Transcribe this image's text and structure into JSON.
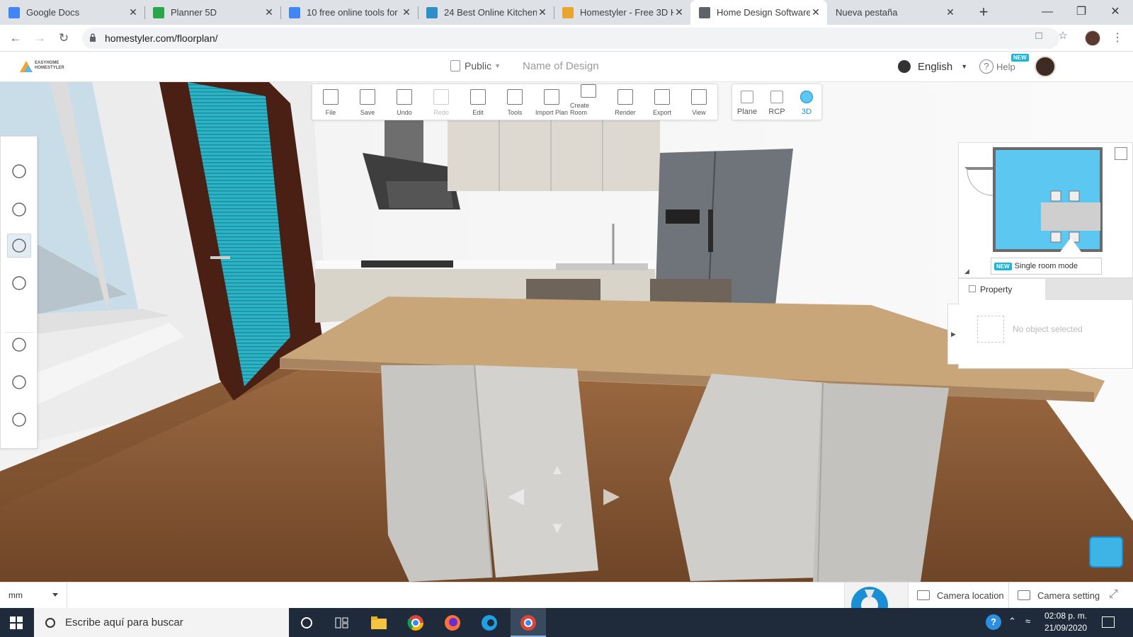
{
  "browser": {
    "tabs": [
      {
        "title": "Google Docs",
        "icon": "google-docs-icon",
        "color": "#4285f4",
        "active": false
      },
      {
        "title": "Planner 5D",
        "icon": "planner5d-icon",
        "color": "#2aa64a",
        "active": false
      },
      {
        "title": "10 free online tools for",
        "icon": "google-docs-icon",
        "color": "#4285f4",
        "active": false
      },
      {
        "title": "24 Best Online Kitchen",
        "icon": "home-icon",
        "color": "#2f8fc9",
        "active": false
      },
      {
        "title": "Homestyler - Free 3D H",
        "icon": "homestyler-icon",
        "color": "#e8a630",
        "active": false
      },
      {
        "title": "Home Design Software",
        "icon": "globe-icon",
        "color": "#5f6368",
        "active": true
      },
      {
        "title": "Nueva pestaña",
        "icon": "",
        "color": "#fff",
        "active": false
      }
    ],
    "url": "homestyler.com/floorplan/"
  },
  "app": {
    "logo_line1": "EASYHOME",
    "logo_line2": "HOMESTYLER",
    "visibility": "Public",
    "design_name_placeholder": "Name of Design",
    "language": "English",
    "help": "Help",
    "new_badge": "NEW"
  },
  "toolbar": {
    "tools": [
      {
        "label": "File",
        "icon": "file-icon",
        "disabled": false
      },
      {
        "label": "Save",
        "icon": "save-icon",
        "disabled": false
      },
      {
        "label": "Undo",
        "icon": "undo-icon",
        "disabled": false
      },
      {
        "label": "Redo",
        "icon": "redo-icon",
        "disabled": true
      },
      {
        "label": "Edit",
        "icon": "edit-icon",
        "disabled": false
      },
      {
        "label": "Tools",
        "icon": "ruler-icon",
        "disabled": false
      },
      {
        "label": "Import Plan",
        "icon": "import-plan-icon",
        "disabled": false
      },
      {
        "label": "Create Room",
        "icon": "create-room-icon",
        "disabled": false
      },
      {
        "label": "Render",
        "icon": "render-icon",
        "disabled": false
      },
      {
        "label": "Export",
        "icon": "export-icon",
        "disabled": false
      },
      {
        "label": "View",
        "icon": "eye-icon",
        "disabled": false
      }
    ],
    "view_modes": [
      {
        "label": "Plane",
        "icon": "plane-icon",
        "active": false
      },
      {
        "label": "RCP",
        "icon": "rcp-icon",
        "active": false
      },
      {
        "label": "3D",
        "icon": "cube-3d-icon",
        "active": true
      }
    ]
  },
  "left_panel": {
    "items": [
      "search-icon",
      "brush-icon",
      "furniture-icon",
      "hammer-icon",
      "compass-icon",
      "favorites-icon",
      "user-icon"
    ],
    "active_index": 2
  },
  "right_panel": {
    "single_room_badge": "NEW",
    "single_room_label": "Single room mode",
    "property_tab": "Property",
    "empty_state": "No object selected"
  },
  "statusbar": {
    "unit": "mm",
    "camera_location": "Camera location",
    "camera_setting": "Camera setting"
  },
  "taskbar": {
    "search_placeholder": "Escribe aquí para buscar",
    "time": "02:08 p. m.",
    "date": "21/09/2020"
  },
  "colors": {
    "accent": "#1a8fd6",
    "door": "#2aa3b8",
    "floor": "#8a5a36",
    "table": "#c9a57a"
  }
}
